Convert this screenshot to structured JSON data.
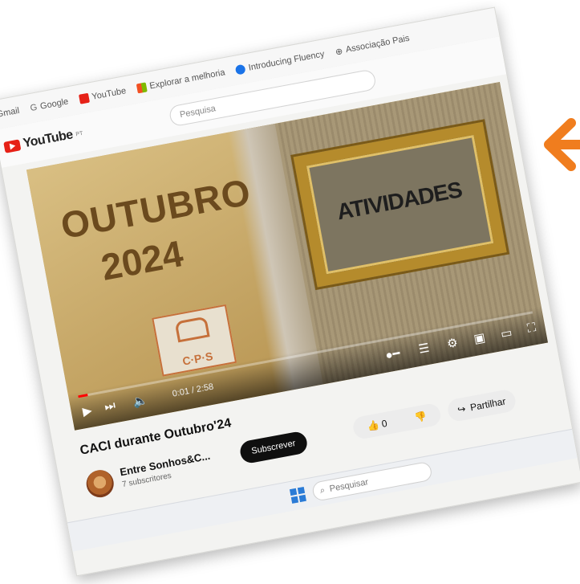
{
  "bookmarks": {
    "items": [
      {
        "label": "Gmail"
      },
      {
        "label": "Google"
      },
      {
        "label": "YouTube"
      },
      {
        "label": "Explorar a melhoria"
      },
      {
        "label": "Introducing Fluency"
      },
      {
        "label": "Associação Pais"
      }
    ]
  },
  "youtube": {
    "logo_text": "YouTube",
    "logo_region": "PT",
    "search_placeholder": "Pesquisa"
  },
  "video": {
    "thumbnail": {
      "line1": "OUTUBRO",
      "line2": "2024",
      "frame_text": "ATIVIDADES",
      "logo_text": "C·P·S"
    },
    "time": "0:01 / 2:58",
    "progress_fraction": 0.02,
    "title": "CACI durante Outubro'24"
  },
  "channel": {
    "name": "Entre Sonhos&C...",
    "subscribers": "7 subscritores",
    "subscribe_label": "Subscrever",
    "likes": "0",
    "share_label": "Partilhar"
  },
  "taskbar": {
    "search_placeholder": "Pesquisar"
  },
  "colors": {
    "accent_arrow": "#f07d1e",
    "youtube_red": "#e62117"
  }
}
